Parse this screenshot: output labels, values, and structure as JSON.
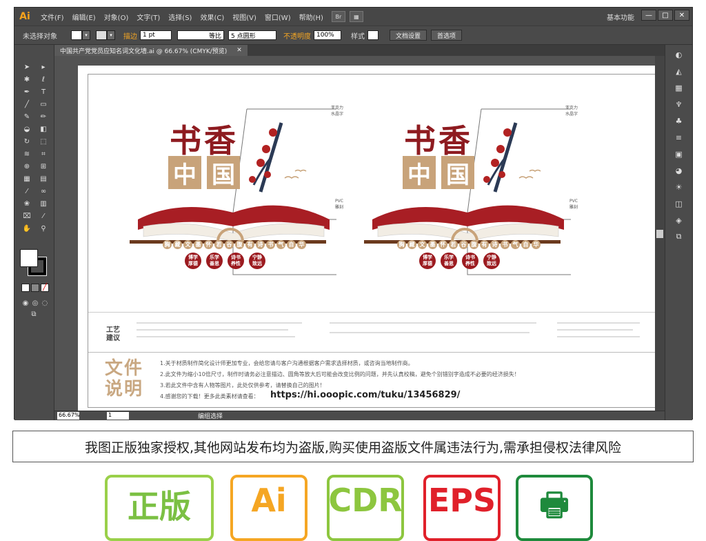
{
  "app": {
    "logo": "Ai",
    "menu": [
      "文件(F)",
      "编辑(E)",
      "对象(O)",
      "文字(T)",
      "选择(S)",
      "效果(C)",
      "视图(V)",
      "窗口(W)",
      "帮助(H)"
    ],
    "bridge_label": "Br",
    "workspace": "基本功能",
    "win_controls": [
      "—",
      "□",
      "✕"
    ]
  },
  "control_bar": {
    "selection": "未选择对象",
    "stroke_label": "描边",
    "stroke_value": "1 pt",
    "stroke_style": "等比",
    "brush": "5 点圆形",
    "opacity_label": "不透明度",
    "opacity_value": "100%",
    "style_label": "样式",
    "doc_setup": "文档设置",
    "preferences": "首选项"
  },
  "document": {
    "tab_title": "中国共产党党员应知名词文化墙.ai @ 66.67% (CMYK/预览)",
    "tab_close": "✕"
  },
  "status": {
    "zoom": "66.67%",
    "page": "1",
    "message": "编组选择"
  },
  "design": {
    "title_top": "书香",
    "title_chars": [
      "中",
      "国"
    ],
    "slogan": [
      "胸",
      "藏",
      "文",
      "墨",
      "怀",
      "若",
      "谷",
      "腹",
      "有",
      "诗",
      "书",
      "气",
      "自",
      "华"
    ],
    "badges": [
      "博学厚德",
      "乐学善思",
      "诗书养性",
      "宁静致远"
    ],
    "label_pvc": "PVC雕刻",
    "label_acrylic": "亚克力水晶字"
  },
  "notes": {
    "craft_title": "工艺建议",
    "file_title": "文件说明",
    "file_lines": [
      "1.关于材质制作简化设计师更加专业，会给您请与客户沟通根据客户需求选择材质，或咨询当地制作商。",
      "2.此文件为缩小10倍尺寸，制作时请务必注意描边、圆角等放大后可能会改变比例的问题，并先认真校稿，避免个别错别字造成不必要的经济损失！",
      "3.若此文件中含有人物等图片，此处仅供参考，请替换自己的图片！",
      "4.感谢您的下载！更多此类素材请查看："
    ],
    "url": "https://hi.ooopic.com/tuku/13456829/"
  },
  "warning": "我图正版独家授权,其他网站发布均为盗版,购买使用盗版文件属违法行为,需承担侵权法律风险",
  "formats": [
    {
      "label": "正版",
      "color": "#7bc043"
    },
    {
      "label": "Ai",
      "color": "#f5a623"
    },
    {
      "label": "CDR",
      "color": "#8dc63f"
    },
    {
      "label": "EPS",
      "color": "#e0202a"
    },
    {
      "label": "",
      "color": "#1e8a3c"
    }
  ]
}
